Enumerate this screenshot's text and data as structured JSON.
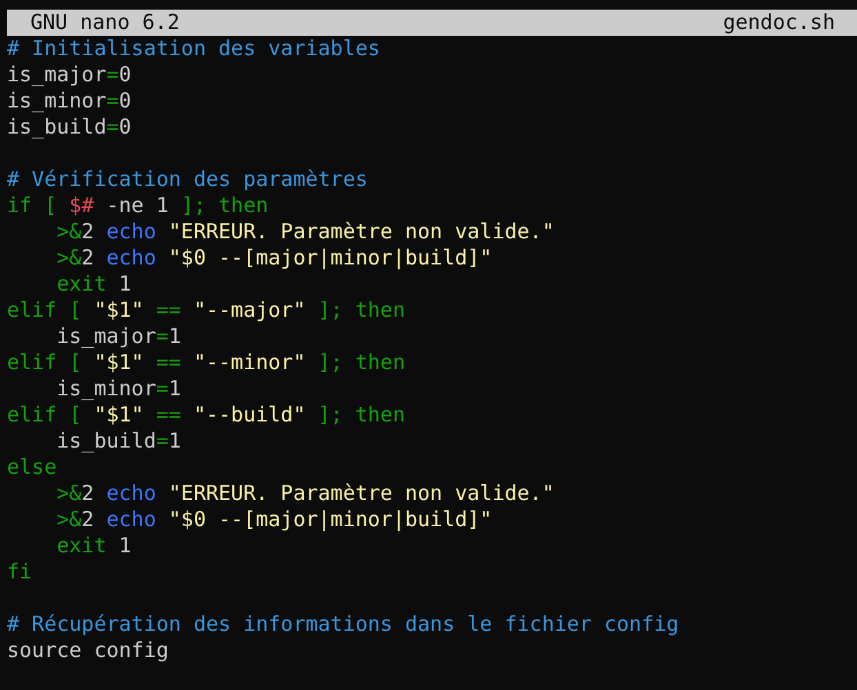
{
  "title_bar": {
    "app": "GNU nano 6.2",
    "file": "gendoc.sh"
  },
  "lines": [
    {
      "tokens": [
        {
          "kind": "comment",
          "text": "# Initialisation des variables"
        }
      ]
    },
    {
      "tokens": [
        {
          "kind": "plain",
          "text": "is_major"
        },
        {
          "kind": "keyword",
          "text": "="
        },
        {
          "kind": "plain",
          "text": "0"
        }
      ]
    },
    {
      "tokens": [
        {
          "kind": "plain",
          "text": "is_minor"
        },
        {
          "kind": "keyword",
          "text": "="
        },
        {
          "kind": "plain",
          "text": "0"
        }
      ]
    },
    {
      "tokens": [
        {
          "kind": "plain",
          "text": "is_build"
        },
        {
          "kind": "keyword",
          "text": "="
        },
        {
          "kind": "plain",
          "text": "0"
        }
      ]
    },
    {
      "gap_before": true,
      "tokens": [
        {
          "kind": "comment",
          "text": "# Vérification des paramètres"
        }
      ]
    },
    {
      "tokens": [
        {
          "kind": "keyword",
          "text": "if [ "
        },
        {
          "kind": "variable",
          "text": "$#"
        },
        {
          "kind": "plain",
          "text": " -ne 1 "
        },
        {
          "kind": "keyword",
          "text": "]; then"
        }
      ]
    },
    {
      "indented": true,
      "tokens": [
        {
          "kind": "keyword",
          "text": ">&"
        },
        {
          "kind": "plain",
          "text": "2 "
        },
        {
          "kind": "builtin",
          "text": "echo"
        },
        {
          "kind": "string",
          "text": " \"ERREUR. Paramètre non valide.\""
        }
      ]
    },
    {
      "indented": true,
      "tokens": [
        {
          "kind": "keyword",
          "text": ">&"
        },
        {
          "kind": "plain",
          "text": "2 "
        },
        {
          "kind": "builtin",
          "text": "echo"
        },
        {
          "kind": "string",
          "text": " \"$0 --[major|minor|build]\""
        }
      ]
    },
    {
      "indented": true,
      "tokens": [
        {
          "kind": "keyword",
          "text": "exit"
        },
        {
          "kind": "plain",
          "text": " 1"
        }
      ]
    },
    {
      "tokens": [
        {
          "kind": "keyword",
          "text": "elif [ "
        },
        {
          "kind": "string",
          "text": "\"$1\""
        },
        {
          "kind": "keyword",
          "text": " == "
        },
        {
          "kind": "string",
          "text": "\"--major\""
        },
        {
          "kind": "keyword",
          "text": " ]; then"
        }
      ]
    },
    {
      "indented": true,
      "tokens": [
        {
          "kind": "plain",
          "text": "is_major"
        },
        {
          "kind": "keyword",
          "text": "="
        },
        {
          "kind": "plain",
          "text": "1"
        }
      ]
    },
    {
      "tokens": [
        {
          "kind": "keyword",
          "text": "elif [ "
        },
        {
          "kind": "string",
          "text": "\"$1\""
        },
        {
          "kind": "keyword",
          "text": " == "
        },
        {
          "kind": "string",
          "text": "\"--minor\""
        },
        {
          "kind": "keyword",
          "text": " ]; then"
        }
      ]
    },
    {
      "indented": true,
      "tokens": [
        {
          "kind": "plain",
          "text": "is_minor"
        },
        {
          "kind": "keyword",
          "text": "="
        },
        {
          "kind": "plain",
          "text": "1"
        }
      ]
    },
    {
      "tokens": [
        {
          "kind": "keyword",
          "text": "elif [ "
        },
        {
          "kind": "string",
          "text": "\"$1\""
        },
        {
          "kind": "keyword",
          "text": " == "
        },
        {
          "kind": "string",
          "text": "\"--build\""
        },
        {
          "kind": "keyword",
          "text": " ]; then"
        }
      ]
    },
    {
      "indented": true,
      "tokens": [
        {
          "kind": "plain",
          "text": "is_build"
        },
        {
          "kind": "keyword",
          "text": "="
        },
        {
          "kind": "plain",
          "text": "1"
        }
      ]
    },
    {
      "tokens": [
        {
          "kind": "keyword",
          "text": "else"
        }
      ]
    },
    {
      "indented": true,
      "tokens": [
        {
          "kind": "keyword",
          "text": ">&"
        },
        {
          "kind": "plain",
          "text": "2 "
        },
        {
          "kind": "builtin",
          "text": "echo"
        },
        {
          "kind": "string",
          "text": " \"ERREUR. Paramètre non valide.\""
        }
      ]
    },
    {
      "indented": true,
      "tokens": [
        {
          "kind": "keyword",
          "text": ">&"
        },
        {
          "kind": "plain",
          "text": "2 "
        },
        {
          "kind": "builtin",
          "text": "echo"
        },
        {
          "kind": "string",
          "text": " \"$0 --[major|minor|build]\""
        }
      ]
    },
    {
      "indented": true,
      "tokens": [
        {
          "kind": "keyword",
          "text": "exit"
        },
        {
          "kind": "plain",
          "text": " 1"
        }
      ]
    },
    {
      "tokens": [
        {
          "kind": "keyword",
          "text": "fi"
        }
      ]
    },
    {
      "gap_before": true,
      "tokens": [
        {
          "kind": "comment",
          "text": "# Récupération des informations dans le fichier config"
        }
      ]
    },
    {
      "tokens": [
        {
          "kind": "plain",
          "text": "source config"
        }
      ]
    }
  ]
}
